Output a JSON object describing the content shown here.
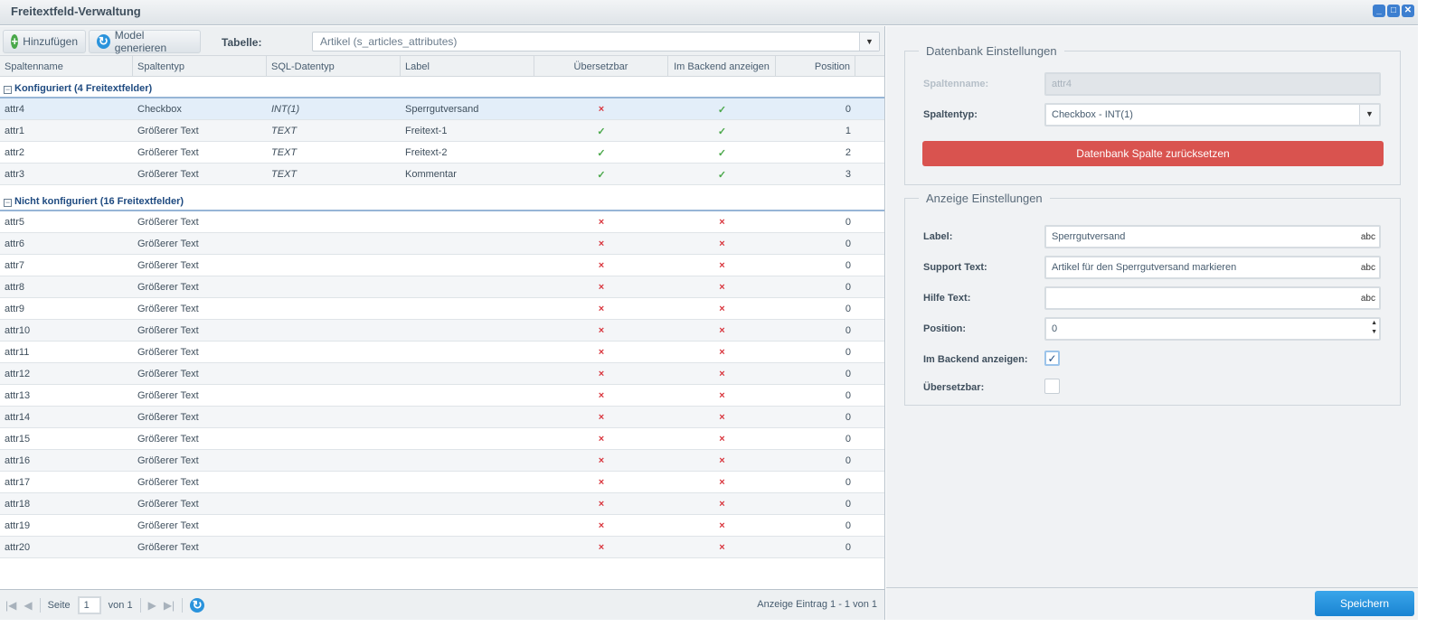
{
  "window": {
    "title": "Freitextfeld-Verwaltung",
    "controls": [
      "_",
      "□",
      "✕"
    ]
  },
  "toolbar": {
    "add": "Hinzufügen",
    "generate": "Model generieren",
    "table_label": "Tabelle:",
    "table_value": "Artikel (s_articles_attributes)"
  },
  "columns": [
    "Spaltenname",
    "Spaltentyp",
    "SQL-Datentyp",
    "Label",
    "Übersetzbar",
    "Im Backend anzeigen",
    "Position"
  ],
  "groups": [
    {
      "title": "Konfiguriert (4 Freitextfelder)",
      "rows": [
        [
          "attr4",
          "Checkbox",
          "INT(1)",
          "Sperrgutversand",
          false,
          true,
          "0"
        ],
        [
          "attr1",
          "Größerer Text",
          "TEXT",
          "Freitext-1",
          true,
          true,
          "1"
        ],
        [
          "attr2",
          "Größerer Text",
          "TEXT",
          "Freitext-2",
          true,
          true,
          "2"
        ],
        [
          "attr3",
          "Größerer Text",
          "TEXT",
          "Kommentar",
          true,
          true,
          "3"
        ]
      ]
    },
    {
      "title": "Nicht konfiguriert (16 Freitextfelder)",
      "rows": [
        [
          "attr5",
          "Größerer Text",
          "",
          "",
          false,
          false,
          "0"
        ],
        [
          "attr6",
          "Größerer Text",
          "",
          "",
          false,
          false,
          "0"
        ],
        [
          "attr7",
          "Größerer Text",
          "",
          "",
          false,
          false,
          "0"
        ],
        [
          "attr8",
          "Größerer Text",
          "",
          "",
          false,
          false,
          "0"
        ],
        [
          "attr9",
          "Größerer Text",
          "",
          "",
          false,
          false,
          "0"
        ],
        [
          "attr10",
          "Größerer Text",
          "",
          "",
          false,
          false,
          "0"
        ],
        [
          "attr11",
          "Größerer Text",
          "",
          "",
          false,
          false,
          "0"
        ],
        [
          "attr12",
          "Größerer Text",
          "",
          "",
          false,
          false,
          "0"
        ],
        [
          "attr13",
          "Größerer Text",
          "",
          "",
          false,
          false,
          "0"
        ],
        [
          "attr14",
          "Größerer Text",
          "",
          "",
          false,
          false,
          "0"
        ],
        [
          "attr15",
          "Größerer Text",
          "",
          "",
          false,
          false,
          "0"
        ],
        [
          "attr16",
          "Größerer Text",
          "",
          "",
          false,
          false,
          "0"
        ],
        [
          "attr17",
          "Größerer Text",
          "",
          "",
          false,
          false,
          "0"
        ],
        [
          "attr18",
          "Größerer Text",
          "",
          "",
          false,
          false,
          "0"
        ],
        [
          "attr19",
          "Größerer Text",
          "",
          "",
          false,
          false,
          "0"
        ],
        [
          "attr20",
          "Größerer Text",
          "",
          "",
          false,
          false,
          "0"
        ]
      ]
    }
  ],
  "pager": {
    "page_label": "Seite",
    "page": "1",
    "of": "von 1",
    "info": "Anzeige Eintrag 1 - 1 von 1"
  },
  "db": {
    "legend": "Datenbank Einstellungen",
    "name_label": "Spaltenname:",
    "name_value": "attr4",
    "type_label": "Spaltentyp:",
    "type_value": "Checkbox - INT(1)",
    "reset": "Datenbank Spalte zurücksetzen"
  },
  "display": {
    "legend": "Anzeige Einstellungen",
    "label_label": "Label:",
    "label_value": "Sperrgutversand",
    "support_label": "Support Text:",
    "support_value": "Artikel für den Sperrgutversand markieren",
    "help_label": "Hilfe Text:",
    "help_value": "",
    "position_label": "Position:",
    "position_value": "0",
    "backend_label": "Im Backend anzeigen:",
    "backend_checked": true,
    "translatable_label": "Übersetzbar:",
    "translatable_checked": false,
    "abc": "abc"
  },
  "save": "Speichern"
}
